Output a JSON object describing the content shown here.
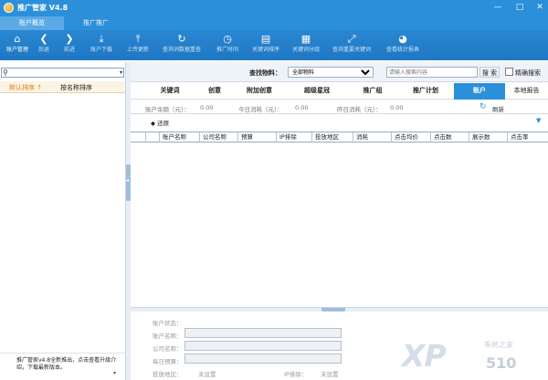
{
  "app": {
    "title": "推广管家 V4.8"
  },
  "window_controls": {
    "minimize": "—",
    "maximize": "□",
    "close": "✕"
  },
  "top_tabs": [
    {
      "label": "账户概览"
    },
    {
      "label": "推广推广"
    }
  ],
  "toolbar": [
    {
      "label": "账户管理",
      "icon": "home-icon"
    },
    {
      "label": "后退",
      "icon": "back-icon"
    },
    {
      "label": "前进",
      "icon": "forward-icon"
    },
    {
      "label": "账户下载",
      "icon": "download-icon"
    },
    {
      "label": "上传更新",
      "icon": "upload-icon"
    },
    {
      "label": "查询词数据重查",
      "icon": "refresh-icon"
    },
    {
      "label": "推广时间",
      "icon": "clock-icon"
    },
    {
      "label": "关键词排序",
      "icon": "chart-icon"
    },
    {
      "label": "关键词分组",
      "icon": "grid-icon"
    },
    {
      "label": "查询重要关键词",
      "icon": "expand-icon"
    },
    {
      "label": "查看统计报表",
      "icon": "pie-icon"
    }
  ],
  "left": {
    "search_placeholder": "",
    "sort_default": "默认排序 ↑",
    "sort_name": "按名称排序",
    "footer_text": "推广管家v4.8全新推出，点击查看升级介绍，下载最新版本。"
  },
  "filter": {
    "label": "查找物料：",
    "selected": "全部物料",
    "keyword_placeholder": "请输入搜索内容",
    "search_button": "搜 索",
    "exact_label": "精确搜索"
  },
  "tabs": [
    "关键词",
    "创意",
    "附加创意",
    "超级星冠",
    "推广组",
    "推广计划",
    "账户",
    "本地报告"
  ],
  "active_tab_index": 6,
  "stats": {
    "balance_label": "账户余额（元）：",
    "balance_value": "0.00",
    "today_label": "今日消耗（元）：",
    "today_value": "0.00",
    "yesterday_label": "昨日消耗（元）：",
    "yesterday_value": "0.00",
    "refresh_label": "刷新"
  },
  "back_label": "◆ 还原",
  "table_columns": [
    "账户名称",
    "公司名称",
    "预算",
    "IP排除",
    "投放地区",
    "消耗",
    "点击均价",
    "点击数",
    "展示数",
    "点击率"
  ],
  "detail": {
    "status_label": "账户状态：",
    "account_name_label": "账户名称：",
    "company_name_label": "公司名称：",
    "daily_budget_label": "每日预算：",
    "region_label": "投放地区：",
    "region_value": "未设置",
    "ip_label": "IP排除：",
    "ip_value": "未设置"
  },
  "watermark": {
    "big": "XP",
    "sub": "系统之家",
    "num": "510"
  }
}
